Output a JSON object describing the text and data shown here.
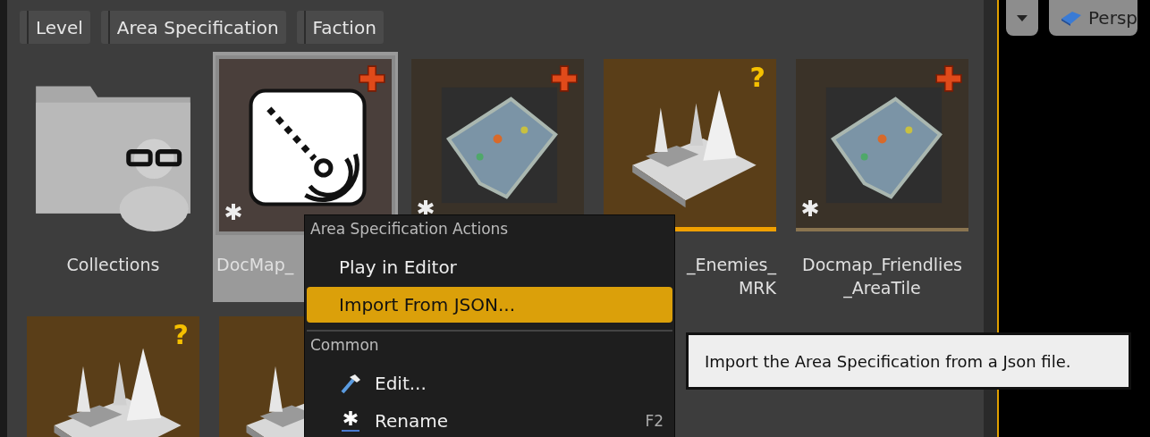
{
  "filters": [
    {
      "label": "Level"
    },
    {
      "label": "Area Specification"
    },
    {
      "label": "Faction"
    }
  ],
  "tiles": [
    {
      "kind": "folder",
      "label": [
        "Collections"
      ],
      "selected": false
    },
    {
      "kind": "area-spec",
      "label": [
        "DocMap_"
      ],
      "plus": true,
      "asterisk": true,
      "selected": true
    },
    {
      "kind": "map",
      "plus": true,
      "asterisk": true,
      "selected": false
    },
    {
      "kind": "level",
      "label": [
        "_Enemies_",
        "MRK"
      ],
      "badge": "?",
      "highlighted": true,
      "selected": false
    },
    {
      "kind": "map",
      "label": [
        "Docmap_Friendlies",
        "_AreaTile"
      ],
      "plus": true,
      "asterisk": true,
      "selected": false
    },
    {
      "kind": "level",
      "badge": "?",
      "selected": false
    },
    {
      "kind": "level",
      "selected": false
    }
  ],
  "context_menu": {
    "sections": [
      {
        "heading": "Area Specification Actions",
        "items": [
          {
            "kind": "plain",
            "label": "Play in Editor",
            "selected": false
          },
          {
            "kind": "plain",
            "label": "Import From JSON...",
            "selected": true
          }
        ]
      },
      {
        "heading": "Common",
        "items": [
          {
            "kind": "hammer",
            "label": "Edit...",
            "selected": false
          },
          {
            "kind": "asterisk",
            "label": "Rename",
            "shortcut": "F2",
            "selected": false
          }
        ]
      }
    ]
  },
  "tooltip": "Import the Area Specification from a Json file.",
  "viewport": {
    "view_button": "Persp"
  }
}
